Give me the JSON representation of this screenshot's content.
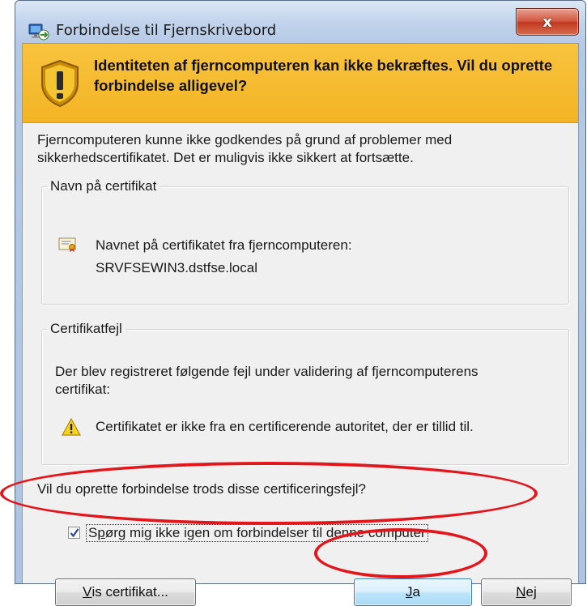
{
  "window": {
    "title": "Forbindelse til Fjernskrivebord",
    "close_symbol": "x"
  },
  "banner": {
    "icon": "warning-shield-icon",
    "text": "Identiteten af fjerncomputeren kan ikke bekræftes. Vil du oprette forbindelse alligevel?"
  },
  "intro": {
    "line1": "Fjerncomputeren kunne ikke godkendes på grund af problemer med",
    "line2": "sikkerhedscertifikatet. Det er muligvis ikke sikkert at fortsætte."
  },
  "cert_name_group": {
    "legend": "Navn på certifikat",
    "icon": "certificate-icon",
    "label": "Navnet på certifikatet fra fjerncomputeren:",
    "value": "SRVFSEWIN3.dstfse.local"
  },
  "cert_error_group": {
    "legend": "Certifikatfejl",
    "line1": "Der blev registreret følgende fejl under validering af fjerncomputerens",
    "line2": "certifikat:",
    "icon": "warning-icon",
    "error": "Certifikatet er ikke fra en certificerende autoritet, der er tillid til."
  },
  "question": "Vil du oprette forbindelse trods disse certificeringsfejl?",
  "checkbox": {
    "checked": true,
    "label_first": "S",
    "label_underlined": "p",
    "label_rest": "ørg mig ikke igen om forbindelser til denne computer"
  },
  "buttons": {
    "view_cert_underlined": "V",
    "view_cert_rest": "is certifikat...",
    "yes_underlined": "J",
    "yes_rest": "a",
    "no_underlined": "N",
    "no_rest": "ej"
  },
  "annotation_color": "#e4161b"
}
